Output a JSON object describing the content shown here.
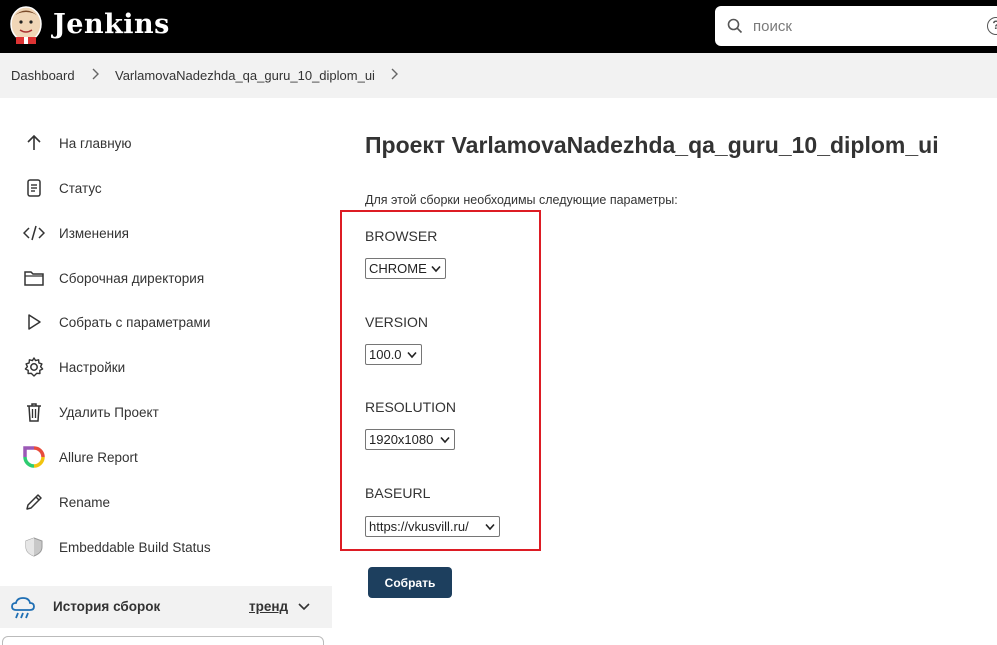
{
  "header": {
    "app_title": "Jenkins",
    "search_placeholder": "поиск",
    "help_glyph": "?"
  },
  "breadcrumb": {
    "items": [
      "Dashboard",
      "VarlamovaNadezhda_qa_guru_10_diplom_ui"
    ]
  },
  "sidebar": {
    "items": [
      {
        "label": "На главную",
        "icon": "arrow-up-icon"
      },
      {
        "label": "Статус",
        "icon": "document-icon"
      },
      {
        "label": "Изменения",
        "icon": "code-icon"
      },
      {
        "label": "Сборочная директория",
        "icon": "folder-icon"
      },
      {
        "label": "Собрать с параметрами",
        "icon": "play-icon"
      },
      {
        "label": "Настройки",
        "icon": "gear-icon"
      },
      {
        "label": "Удалить Проект",
        "icon": "trash-icon"
      },
      {
        "label": "Allure Report",
        "icon": "allure-icon"
      },
      {
        "label": "Rename",
        "icon": "pencil-icon"
      },
      {
        "label": "Embeddable Build Status",
        "icon": "shield-icon"
      }
    ],
    "history": {
      "title": "История сборок",
      "trend_label": "тренд"
    }
  },
  "main": {
    "title": "Проект VarlamovaNadezhda_qa_guru_10_diplom_ui",
    "description": "Для этой сборки необходимы следующие параметры:",
    "params": [
      {
        "name": "BROWSER",
        "value": "CHROME"
      },
      {
        "name": "VERSION",
        "value": "100.0"
      },
      {
        "name": "RESOLUTION",
        "value": "1920x1080"
      },
      {
        "name": "BASEURL",
        "value": "https://vkusvill.ru/"
      }
    ],
    "build_button": "Собрать"
  },
  "colors": {
    "header_bg": "#000000",
    "breadcrumb_bg": "#f2f2f2",
    "highlight": "#dd1c24",
    "button_bg": "#1d3f5e"
  }
}
